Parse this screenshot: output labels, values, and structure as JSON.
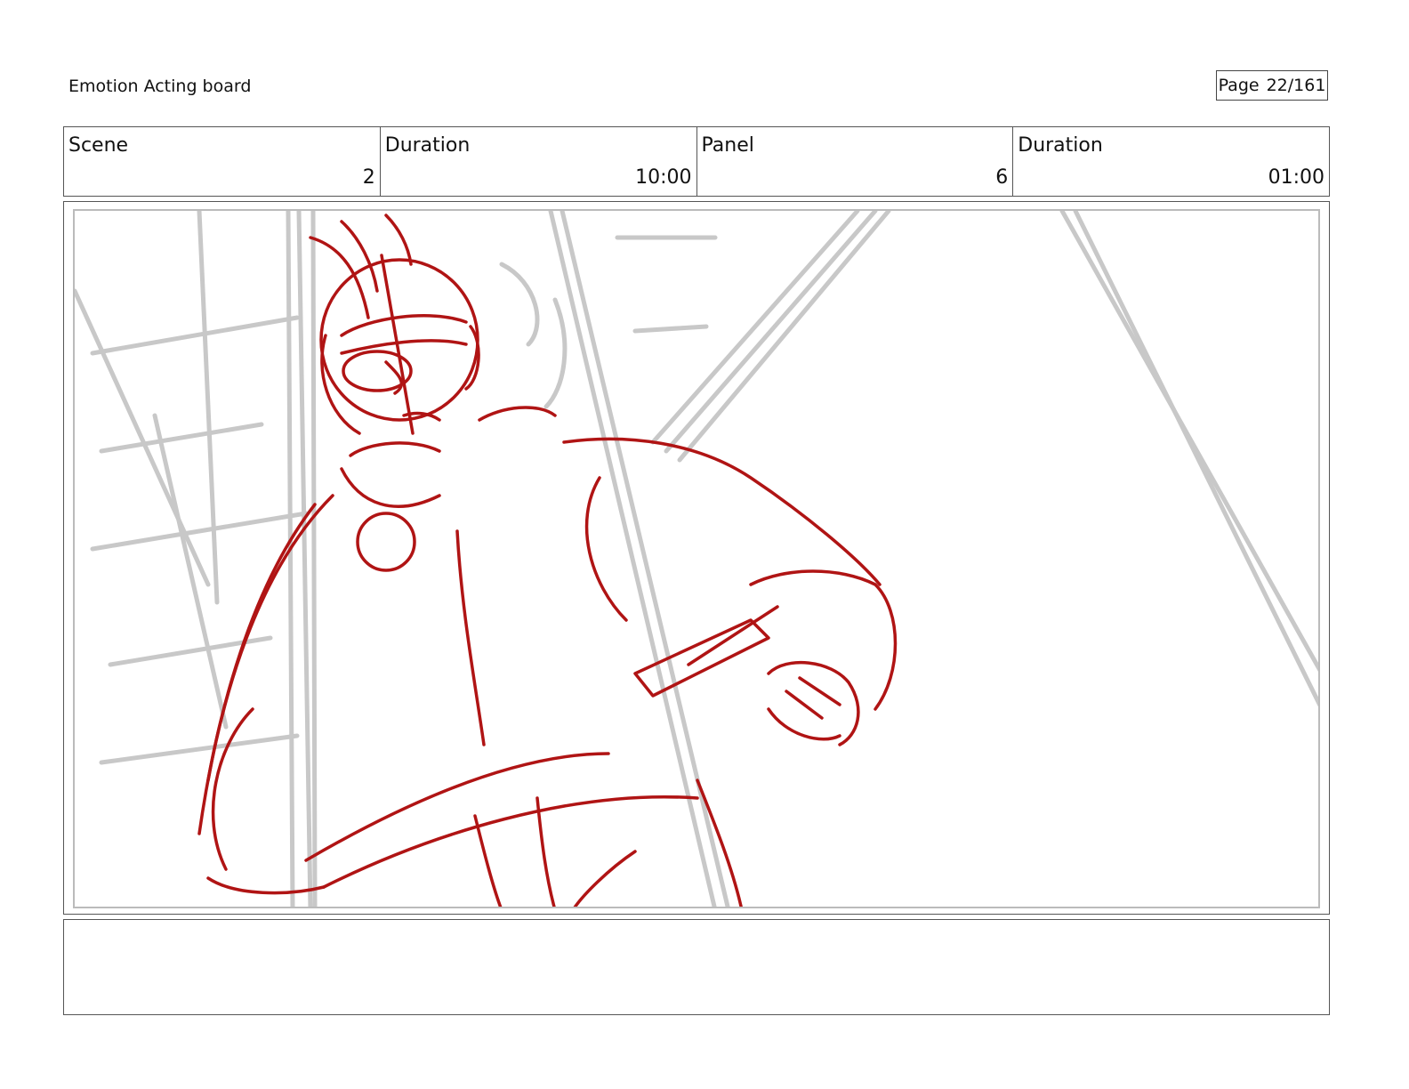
{
  "header": {
    "board_title": "Emotion Acting board",
    "page_label": "Page",
    "page_number": "22/161"
  },
  "info": {
    "scene_label": "Scene",
    "scene_value": "2",
    "scene_duration_label": "Duration",
    "scene_duration_value": "10:00",
    "panel_label": "Panel",
    "panel_value": "6",
    "panel_duration_label": "Duration",
    "panel_duration_value": "01:00"
  },
  "panel": {
    "sketch_colors": {
      "rough": "#c8c8c8",
      "character": "#b01414"
    }
  },
  "notes": {
    "text": ""
  }
}
